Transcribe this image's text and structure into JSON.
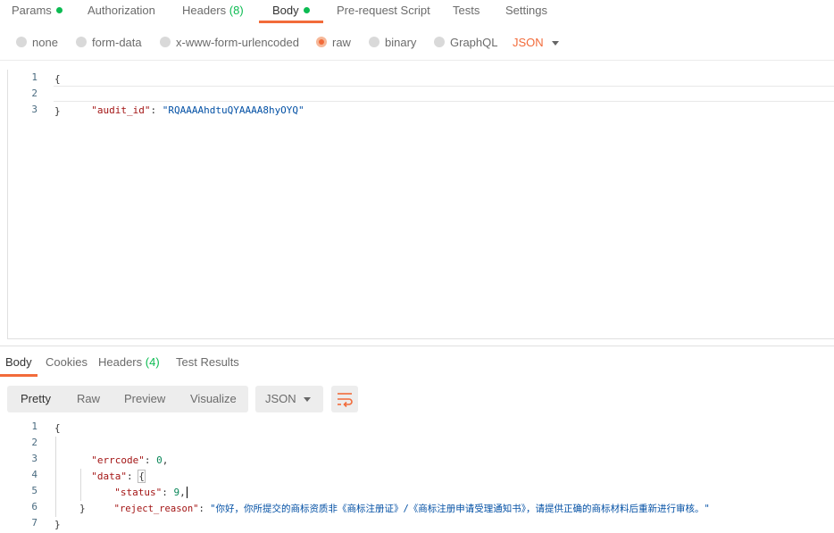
{
  "request_tabs": {
    "params": "Params",
    "authorization": "Authorization",
    "headers": "Headers",
    "headers_count": "(8)",
    "body": "Body",
    "pre_request": "Pre-request Script",
    "tests": "Tests",
    "settings": "Settings"
  },
  "body_types": {
    "none": "none",
    "form_data": "form-data",
    "urlencoded": "x-www-form-urlencoded",
    "raw": "raw",
    "binary": "binary",
    "graphql": "GraphQL",
    "language": "JSON",
    "selected": "raw"
  },
  "request_body": {
    "line_numbers": [
      "1",
      "2",
      "3"
    ],
    "open": "{",
    "key": "\"audit_id\"",
    "colon": ": ",
    "value": "\"RQAAAAhdtuQYAAAA8hyOYQ\"",
    "close": "}"
  },
  "response_tabs": {
    "body": "Body",
    "cookies": "Cookies",
    "headers": "Headers",
    "headers_count": "(4)",
    "test_results": "Test Results"
  },
  "view_modes": {
    "pretty": "Pretty",
    "raw": "Raw",
    "preview": "Preview",
    "visualize": "Visualize",
    "format": "JSON"
  },
  "response_body": {
    "line_numbers": [
      "1",
      "2",
      "3",
      "4",
      "5",
      "6",
      "7"
    ],
    "l1": "{",
    "errcode_key": "\"errcode\"",
    "errcode_val": "0",
    "data_key": "\"data\"",
    "data_open": "{",
    "status_key": "\"status\"",
    "status_val": "9",
    "reject_key": "\"reject_reason\"",
    "reject_val": "\"你好，你所提交的商标资质非《商标注册证》/《商标注册申请受理通知书》，请提供正确的商标材料后重新进行审核。\"",
    "data_close": "}",
    "l7": "}"
  },
  "colors": {
    "accent": "#f26b3a",
    "success": "#0cbb52"
  }
}
